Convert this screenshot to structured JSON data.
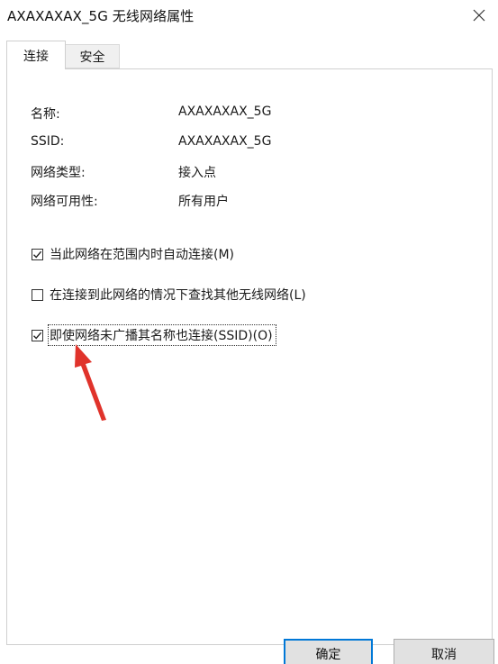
{
  "window": {
    "title": "AXAXAXAX_5G 无线网络属性"
  },
  "tabs": [
    {
      "label": "连接",
      "selected": true
    },
    {
      "label": "安全",
      "selected": false
    }
  ],
  "info": [
    {
      "label": "名称:",
      "value": "AXAXAXAX_5G"
    },
    {
      "label": "SSID:",
      "value": "AXAXAXAX_5G"
    },
    {
      "label": "网络类型:",
      "value": "接入点"
    },
    {
      "label": "网络可用性:",
      "value": "所有用户"
    }
  ],
  "options": [
    {
      "label": "当此网络在范围内时自动连接(M)",
      "checked": true
    },
    {
      "label": "在连接到此网络的情况下查找其他无线网络(L)",
      "checked": false
    },
    {
      "label": "即使网络未广播其名称也连接(SSID)(O)",
      "checked": true
    }
  ],
  "buttons": {
    "ok_label": "确定",
    "cancel_label": "取消"
  },
  "colors": {
    "accent": "#0078d7",
    "annotation_arrow": "#e0332b"
  },
  "icons": {
    "close": "close-icon",
    "check": "check-icon",
    "arrow": "red-arrow-annotation"
  }
}
